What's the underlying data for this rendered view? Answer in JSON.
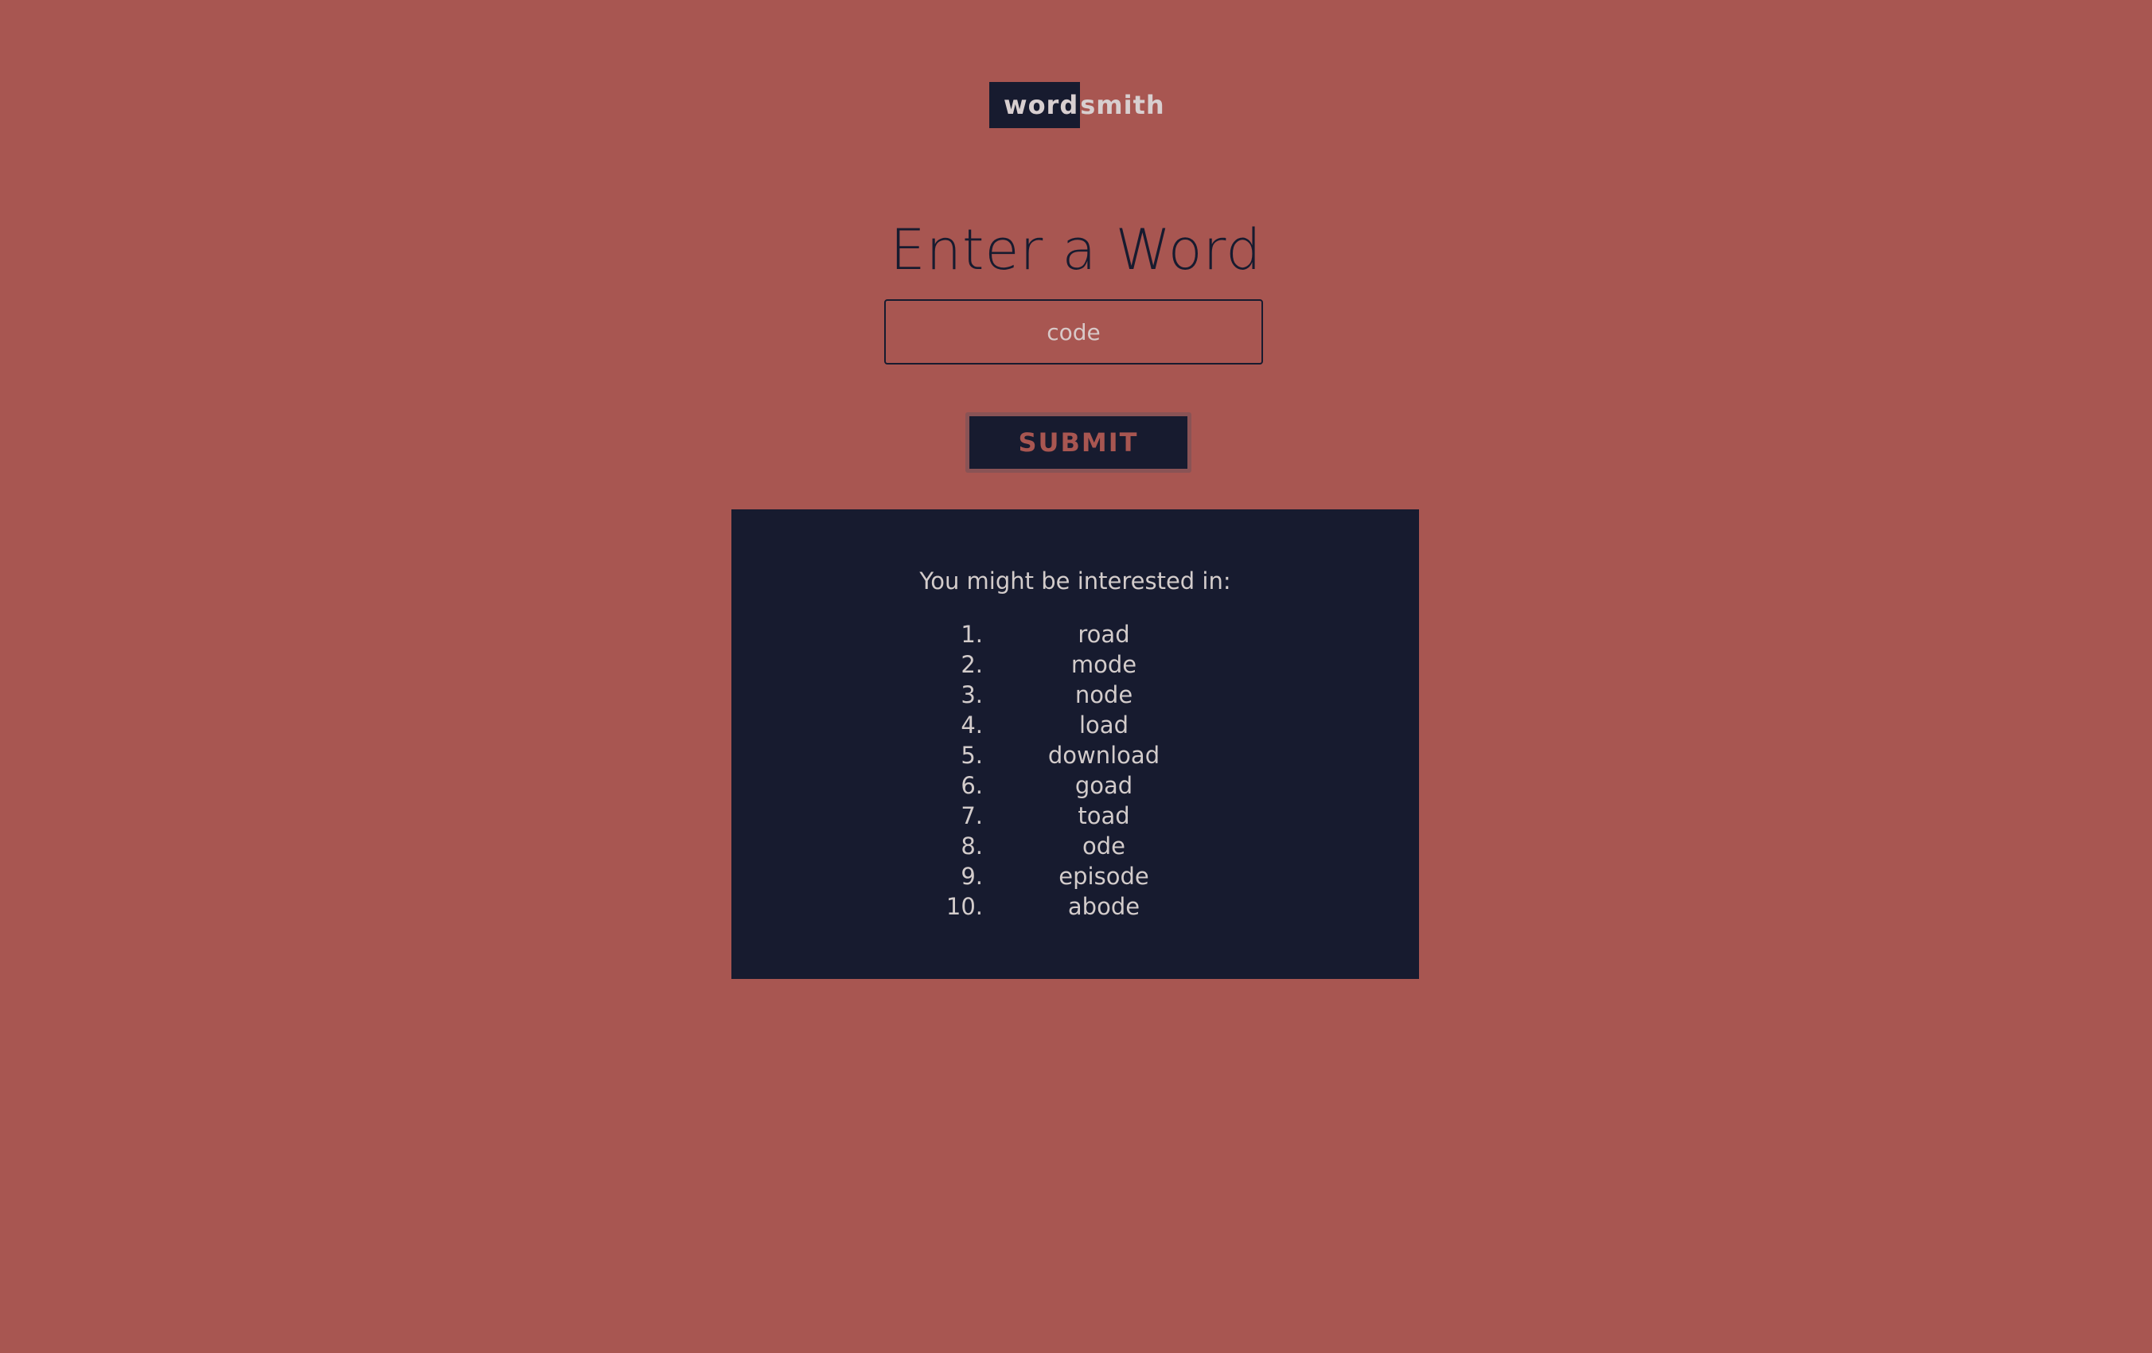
{
  "header": {
    "logo_part1": "word",
    "logo_part2": "smith"
  },
  "form": {
    "heading": "Enter a Word",
    "input_value": "code",
    "submit_label": "SUBMIT"
  },
  "results": {
    "title": "You might be interested in:",
    "items": [
      {
        "num": "1.",
        "word": "road"
      },
      {
        "num": "2.",
        "word": "mode"
      },
      {
        "num": "3.",
        "word": "node"
      },
      {
        "num": "4.",
        "word": "load"
      },
      {
        "num": "5.",
        "word": "download"
      },
      {
        "num": "6.",
        "word": "goad"
      },
      {
        "num": "7.",
        "word": "toad"
      },
      {
        "num": "8.",
        "word": "ode"
      },
      {
        "num": "9.",
        "word": "episode"
      },
      {
        "num": "10.",
        "word": "abode"
      }
    ]
  },
  "colors": {
    "background": "#a85651",
    "panel": "#171b2f",
    "text_light": "#d3cccb"
  }
}
